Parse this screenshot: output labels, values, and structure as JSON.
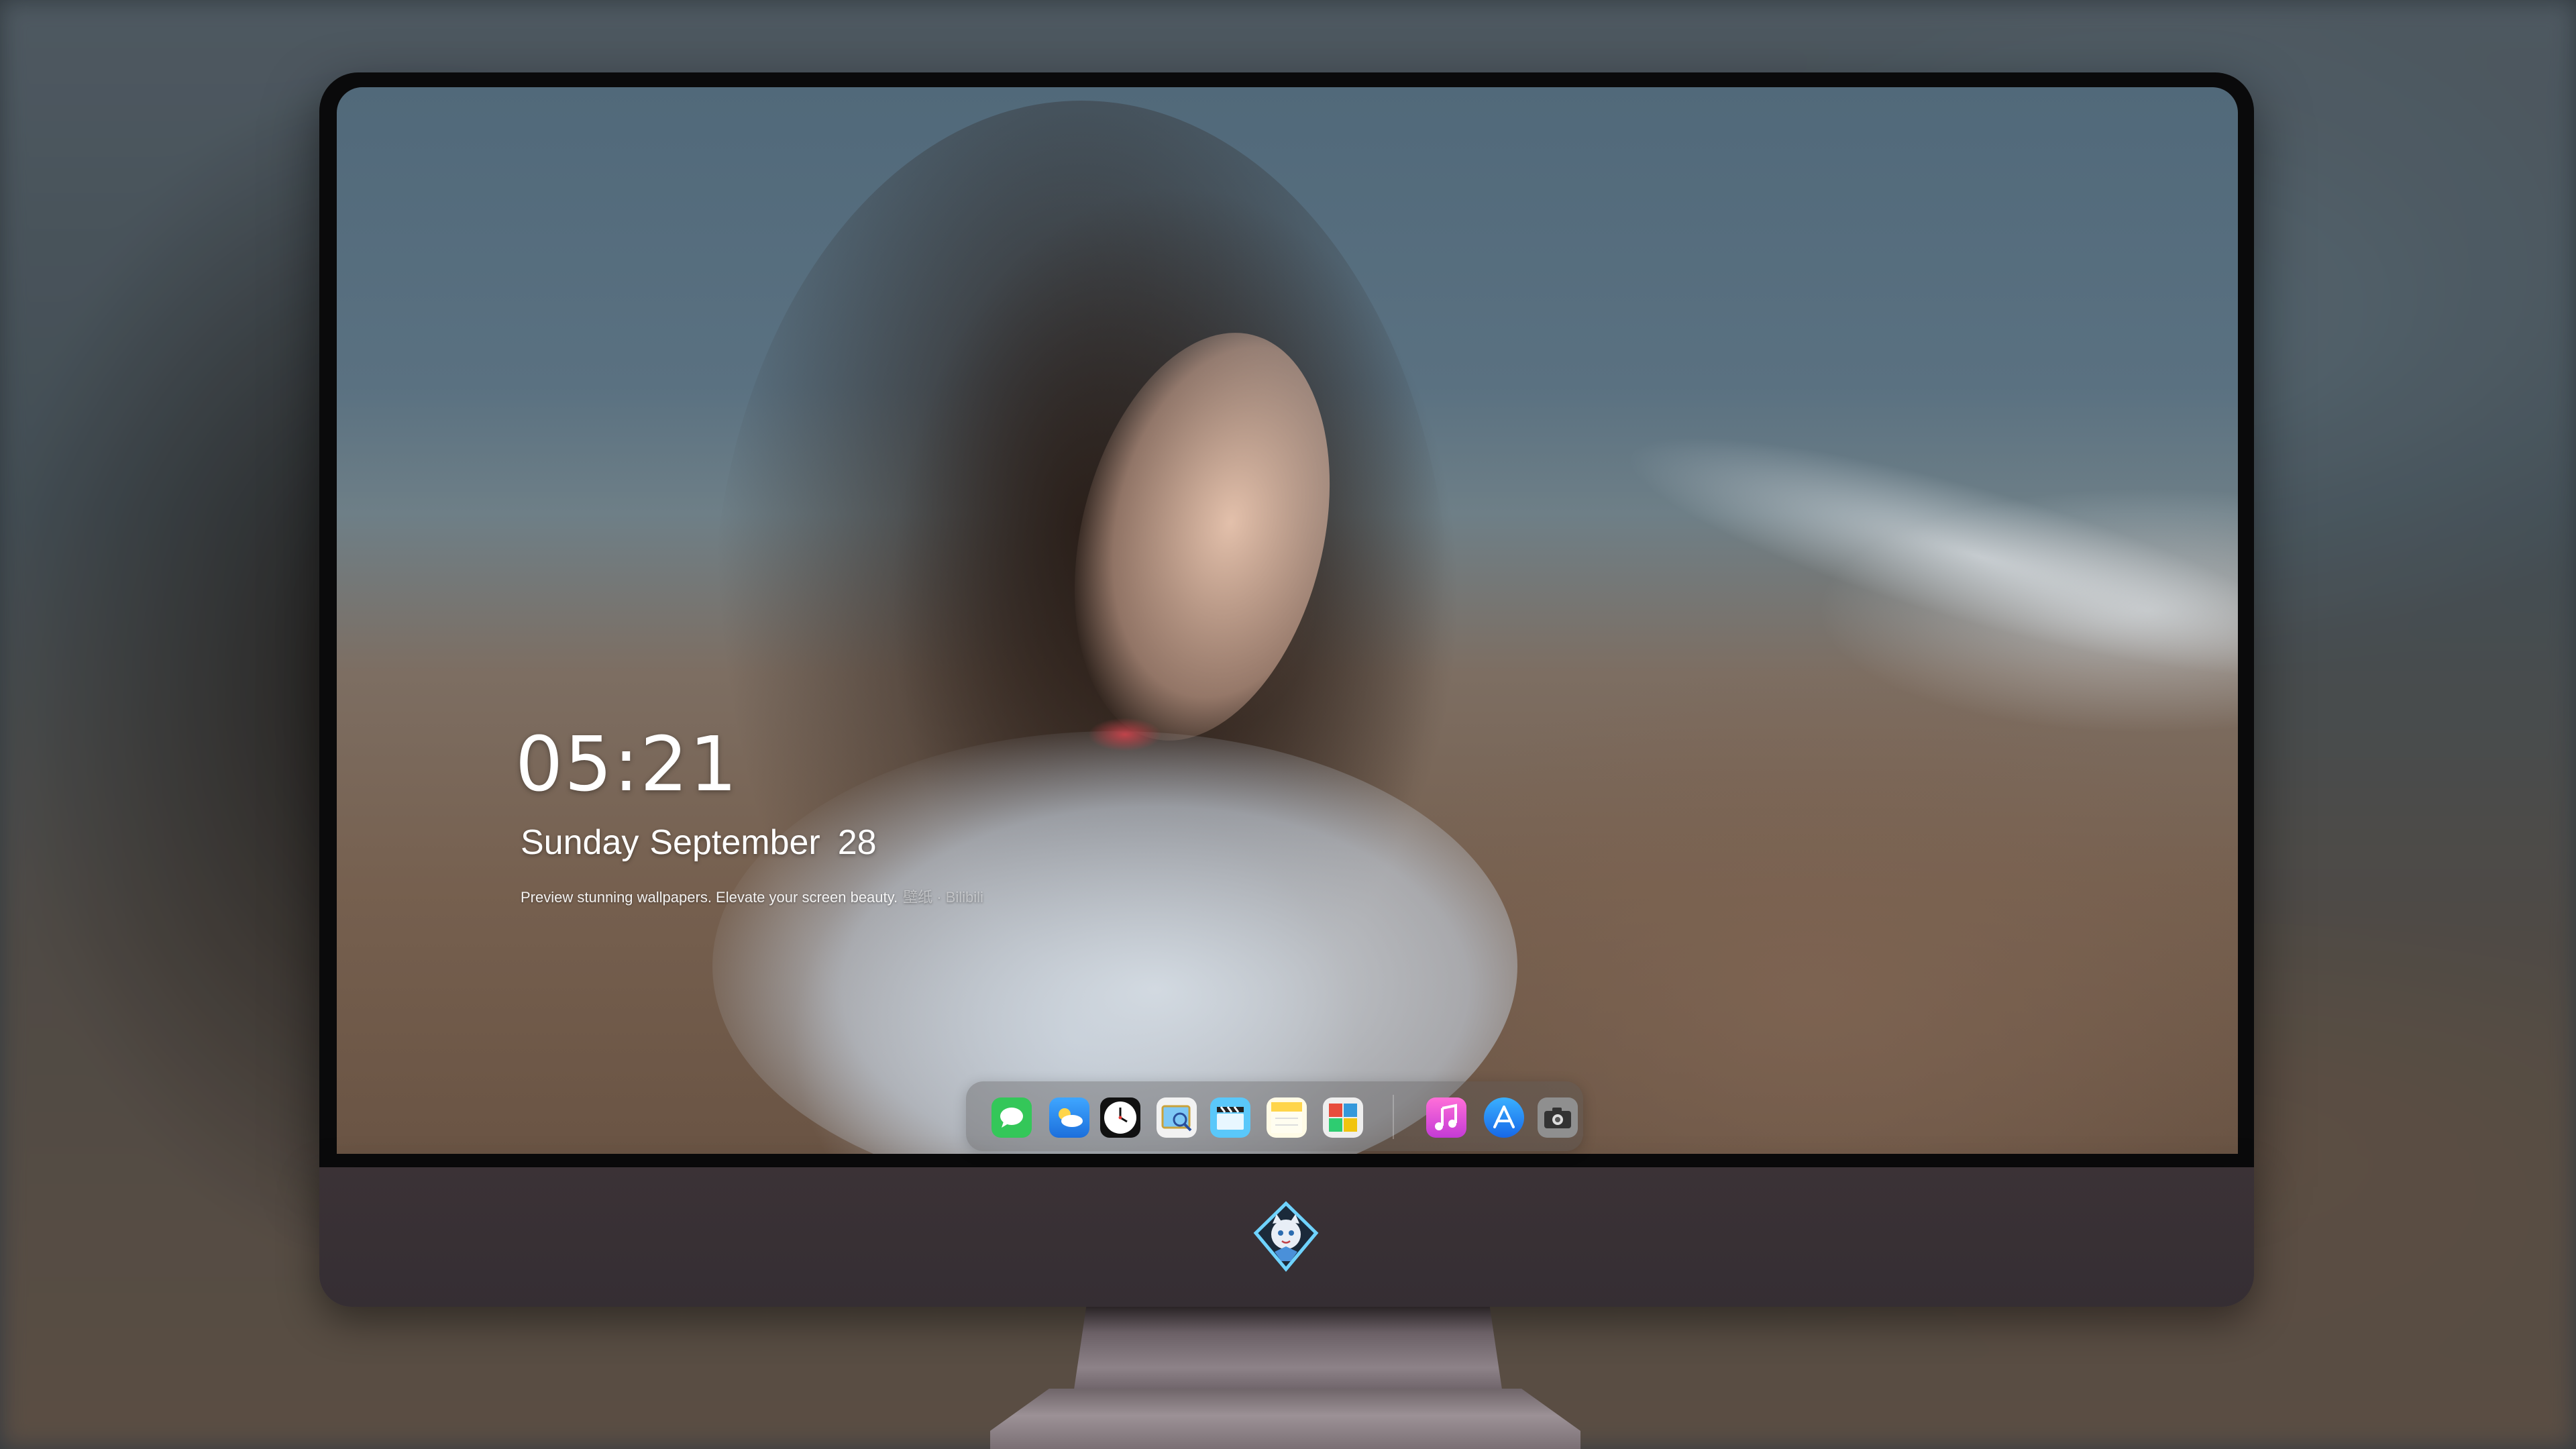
{
  "lockscreen": {
    "time": "05:21",
    "weekday": "Sunday",
    "month": "September",
    "day": "28",
    "preview_text": "Preview stunning wallpapers. Elevate your screen beauty.",
    "preview_faded": "壁纸 · Bilibili"
  },
  "dock": {
    "apps": [
      {
        "name": "Messages",
        "icon": "message-icon",
        "color": "#34c759"
      },
      {
        "name": "Weather",
        "icon": "weather-icon",
        "color": "#2f8cf0"
      },
      {
        "name": "Clock",
        "icon": "clock-icon",
        "color": "#111111"
      },
      {
        "name": "Preview",
        "icon": "preview-icon",
        "color": "#f2f2f2"
      },
      {
        "name": "Clips",
        "icon": "clapper-icon",
        "color": "#5ac8fa"
      },
      {
        "name": "Notes",
        "icon": "notes-icon",
        "color": "#ffd54a"
      },
      {
        "name": "Photo Booth",
        "icon": "photos-grid-icon",
        "color": "#e8e8e8"
      },
      {
        "name": "Music",
        "icon": "music-icon",
        "color": "#e04dd0"
      },
      {
        "name": "App Store",
        "icon": "app-store-icon",
        "color": "#1e90ff"
      },
      {
        "name": "Camera",
        "icon": "camera-icon",
        "color": "#9a9a9a"
      }
    ]
  },
  "colors": {
    "chin": "#352e33",
    "bezel": "#0a0a0b",
    "dock_bg": "rgba(90,86,88,0.38)"
  }
}
